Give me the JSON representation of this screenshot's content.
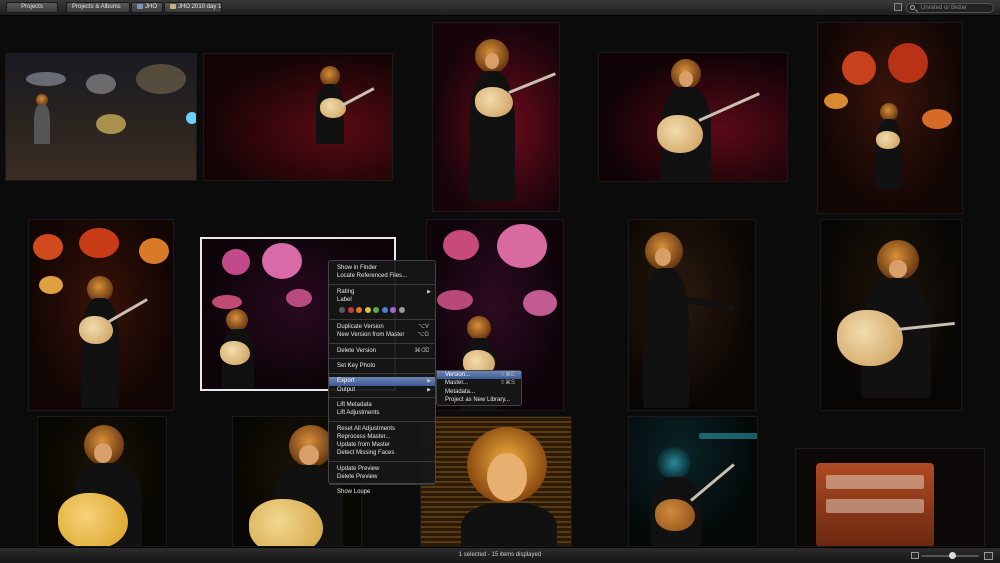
{
  "toolbar": {
    "crumbs": [
      "Projects",
      "Projects & Albums",
      "JHO",
      "JHO 2010 day 1"
    ],
    "search_placeholder": "Unrated or Better",
    "icons": {
      "view": "view-toggle-icon",
      "search": "search-icon"
    }
  },
  "context_menu": {
    "items": {
      "show_in_finder": "Show in Finder",
      "locate_files": "Locate Referenced Files...",
      "rating": "Rating",
      "label": "Label",
      "duplicate_version": "Duplicate Version",
      "duplicate_version_sc": "⌥V",
      "new_version": "New Version from Master",
      "new_version_sc": "⌥G",
      "delete_version": "Delete Version",
      "delete_version_sc": "⌘⌫",
      "set_key_photo": "Set Key Photo",
      "export": "Export",
      "output": "Output",
      "lift_metadata": "Lift Metadata",
      "lift_adjustments": "Lift Adjustments",
      "reset_adjustments": "Reset All Adjustments",
      "reprocess_master": "Reprocess Master...",
      "update_from_master": "Update from Master",
      "detect_faces": "Detect Missing Faces",
      "update_preview": "Update Preview",
      "delete_preview": "Delete Preview",
      "show_loupe": "Show Loupe"
    },
    "label_colors": [
      "#5a5a5a",
      "#c43b3b",
      "#d87a2c",
      "#d8c43c",
      "#5caa4a",
      "#4a7fd0",
      "#9a6ad0",
      "#999999"
    ]
  },
  "export_submenu": {
    "version": "Version...",
    "version_sc": "⇧⌘E",
    "master": "Master...",
    "master_sc": "⇧⌘S",
    "metadata": "Metadata...",
    "project_library": "Project as New Library..."
  },
  "status": {
    "text": "1 selected - 15 items displayed",
    "zoom": 0.55
  },
  "colors": {
    "accent": "#4a6aa8",
    "background": "#0b0b0b"
  }
}
